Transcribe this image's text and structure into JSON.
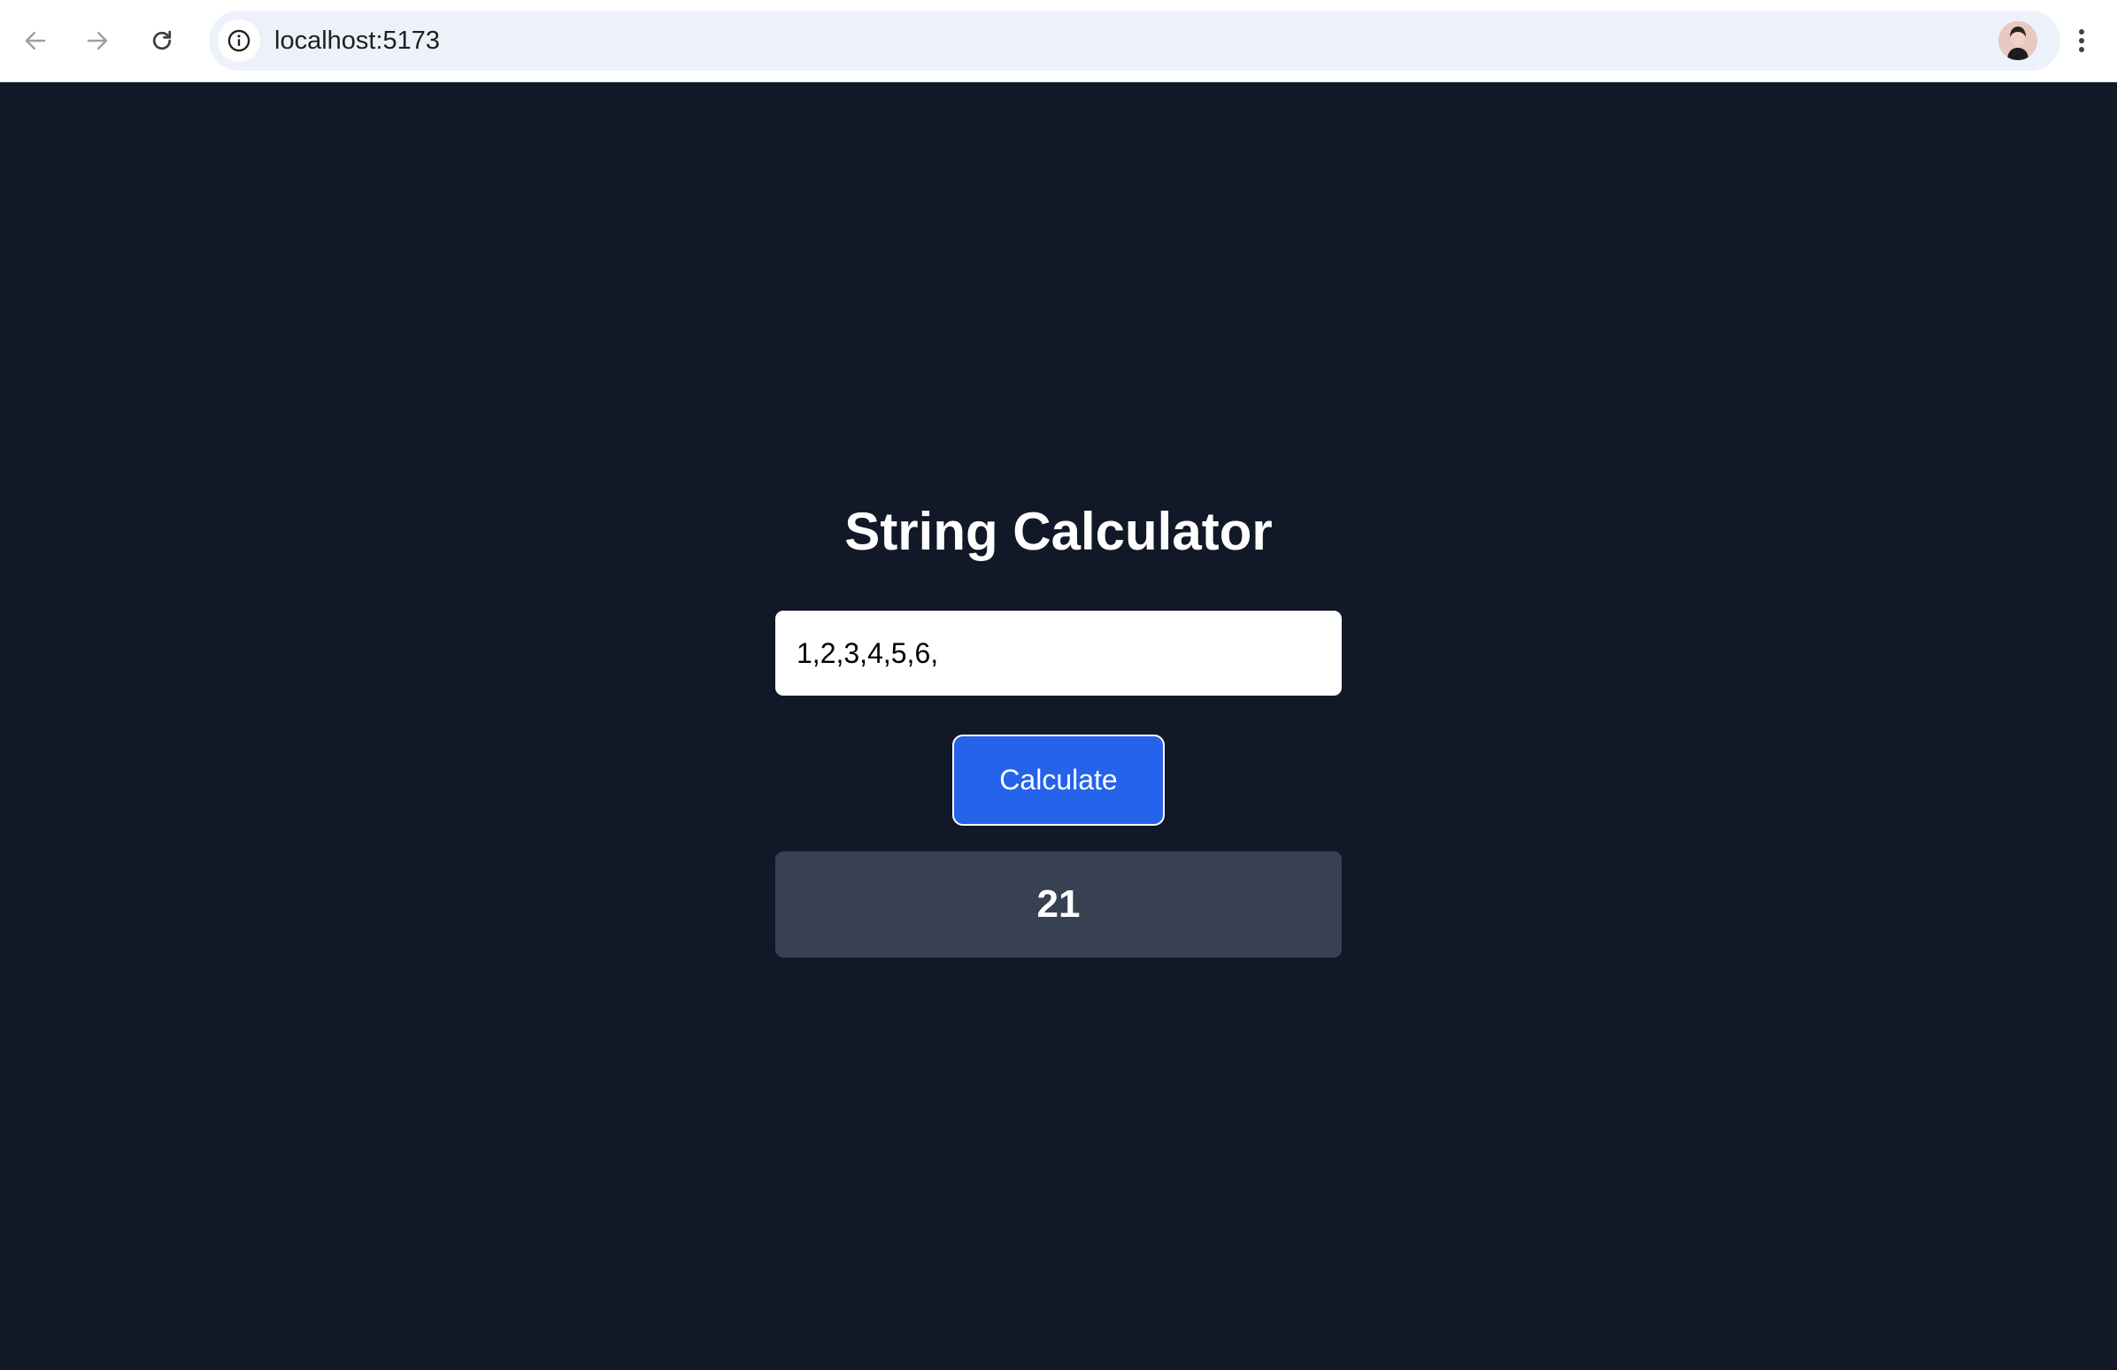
{
  "browser": {
    "url": "localhost:5173",
    "icons": {
      "back": "arrow-left-icon",
      "forward": "arrow-right-icon",
      "reload": "reload-icon",
      "site_info": "info-icon",
      "bookmark": "star-icon",
      "profile": "avatar",
      "menu": "kebab-menu-icon"
    }
  },
  "app": {
    "title": "String Calculator",
    "input_value": "1,2,3,4,5,6,",
    "button_label": "Calculate",
    "result": "21"
  },
  "colors": {
    "page_background": "#111827",
    "button_background": "#2563eb",
    "result_background": "#374151",
    "text": "#ffffff"
  }
}
